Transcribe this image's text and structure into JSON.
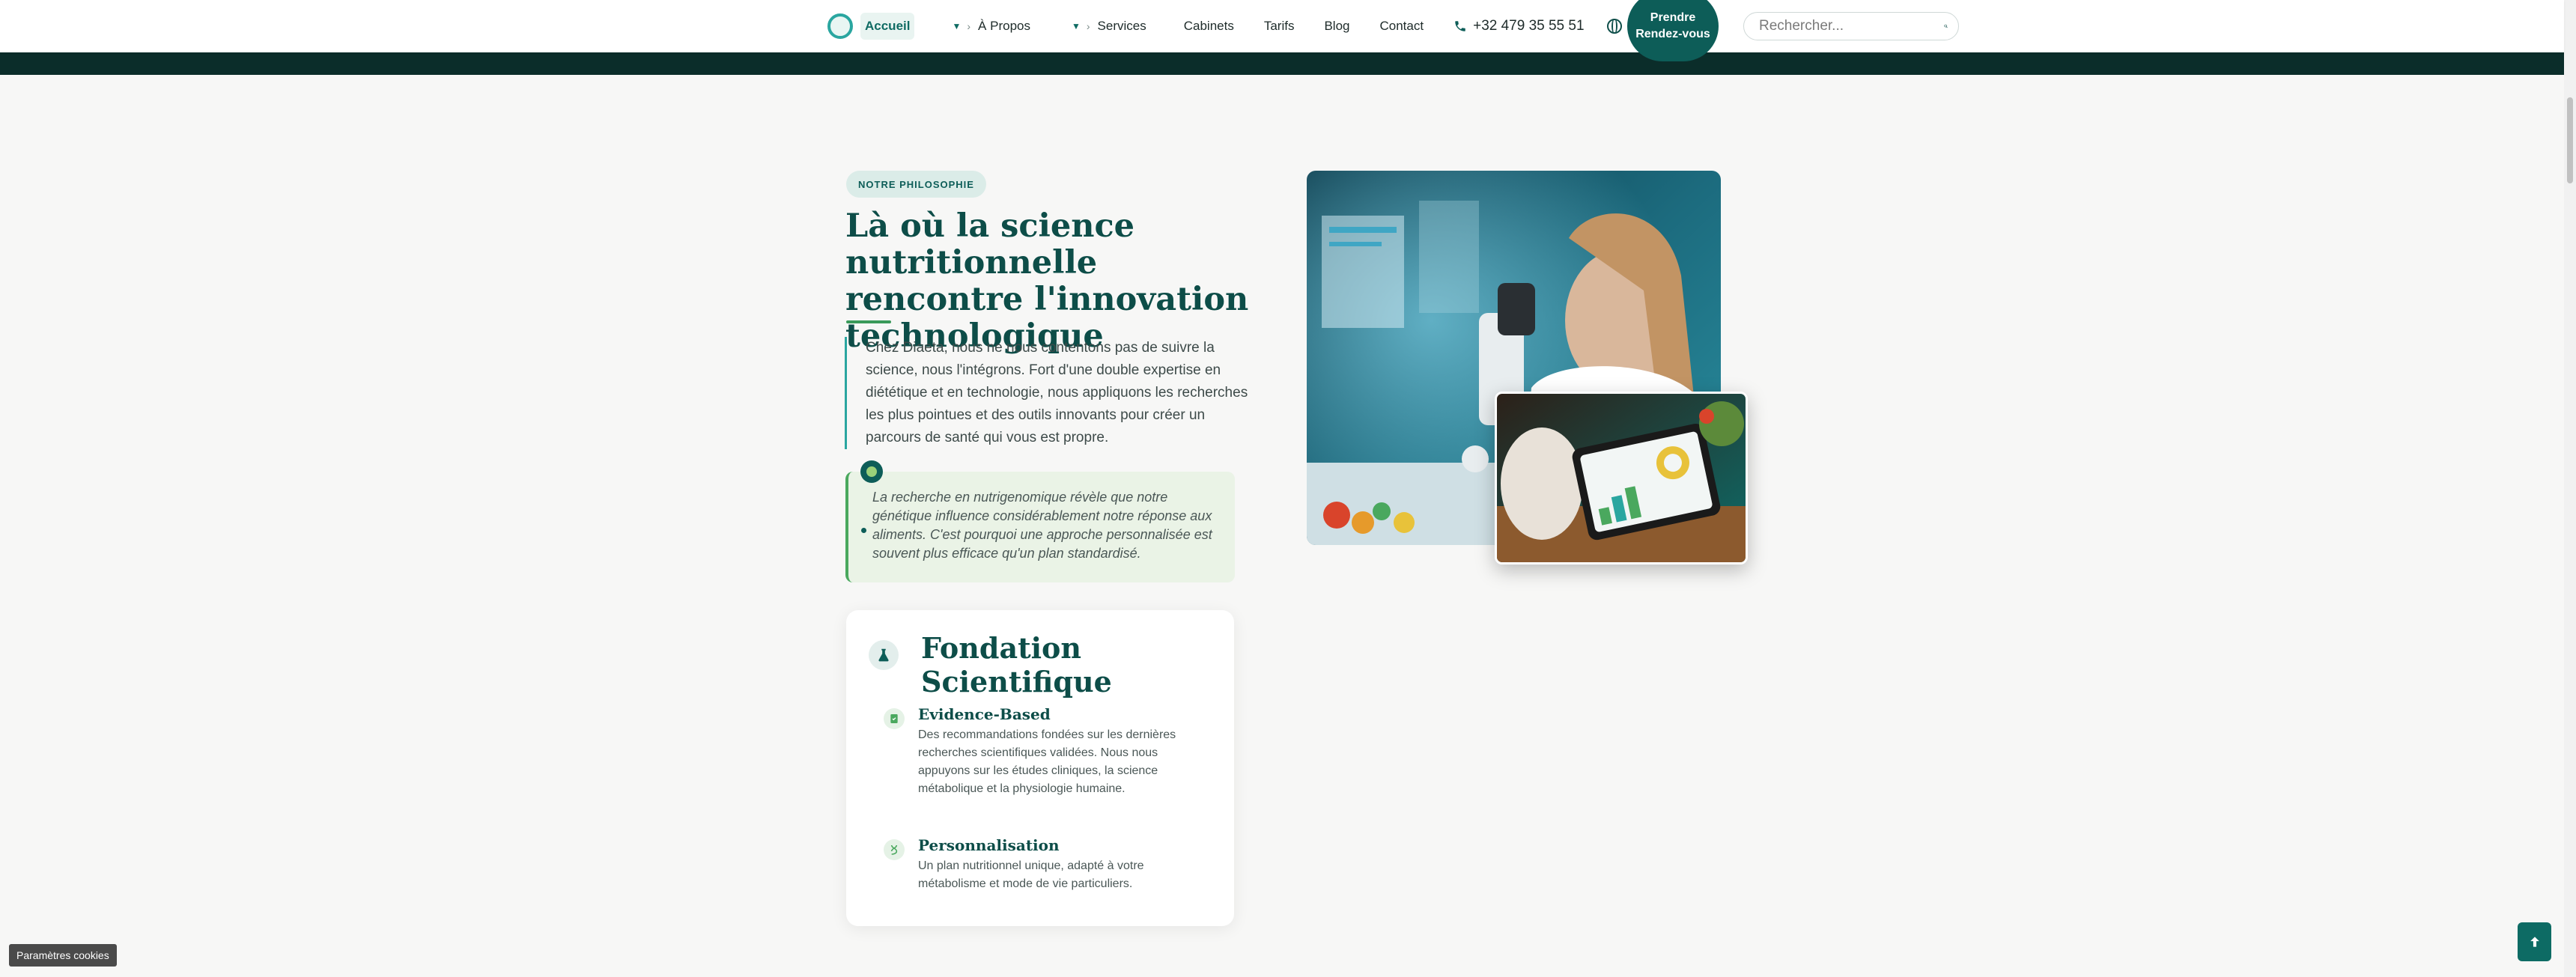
{
  "header": {
    "logo_alt": "",
    "nav": [
      {
        "label": "Accueil",
        "active": true
      },
      {
        "label": "À Propos",
        "dropdown": true
      },
      {
        "label": "Services",
        "dropdown": true
      },
      {
        "label": "Cabinets"
      },
      {
        "label": "Tarifs"
      },
      {
        "label": "Blog"
      },
      {
        "label": "Contact"
      }
    ],
    "phone": "+32 479 35 55 51",
    "language": "FR",
    "cta_label": "Prendre Rendez-vous",
    "search_placeholder": "Rechercher..."
  },
  "section": {
    "badge": "NOTRE PHILOSOPHIE",
    "title": "Là où la science nutritionnelle rencontre l'innovation technologique",
    "paragraph": "Chez Diaeta, nous ne nous contentons pas de suivre la science, nous l'intégrons. Fort d'une double expertise en diététique et en technologie, nous appliquons les recherches les plus pointues et des outils innovants pour créer un parcours de santé qui vous est propre.",
    "quote": "La recherche en nutrigenomique révèle que notre génétique influence considérablement notre réponse aux aliments. C'est pourquoi une approche personnalisée est souvent plus efficace qu'un plan standardisé."
  },
  "card": {
    "title": "Fondation Scientifique",
    "features": [
      {
        "title": "Evidence-Based",
        "description": "Des recommandations fondées sur les dernières recherches scientifiques validées. Nous nous appuyons sur les études cliniques, la science métabolique et la physiologie humaine."
      },
      {
        "title": "Personnalisation",
        "description": "Un plan nutritionnel unique, adapté à votre métabolisme et mode de vie particuliers."
      }
    ]
  },
  "footer": {
    "cookie_label": "Paramètres cookies"
  },
  "colors": {
    "primary": "#0d5d58",
    "heading": "#0d4d48",
    "accent_green": "#4aa85e",
    "dark_band": "#0b2d2a"
  },
  "icons": [
    "logo",
    "chevron-right-icon",
    "phone-icon",
    "globe-icon",
    "search-icon",
    "lightbulb-icon",
    "flask-icon",
    "document-check-icon",
    "dna-icon",
    "arrow-up-icon"
  ]
}
